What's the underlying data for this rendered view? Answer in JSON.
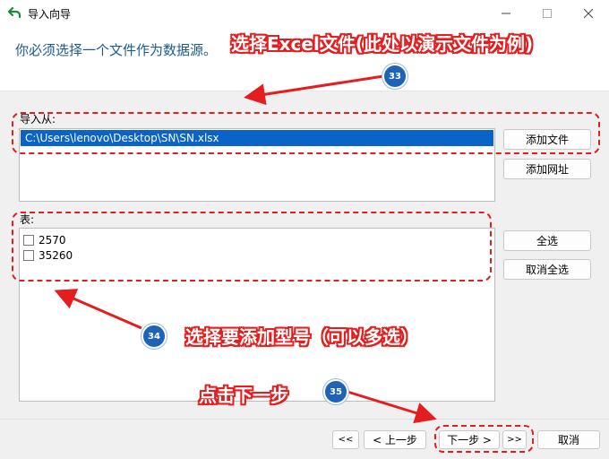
{
  "window": {
    "title": "导入向导",
    "minimize_icon": "minimize-icon",
    "maximize_icon": "maximize-icon",
    "close_icon": "close-icon"
  },
  "instruction": "你必须选择一个文件作为数据源。",
  "import_from": {
    "label": "导入从:",
    "files": [
      "C:\\Users\\lenovo\\Desktop\\SN\\SN.xlsx"
    ],
    "add_file_button": "添加文件",
    "add_url_button": "添加网址"
  },
  "tables": {
    "label": "表:",
    "items": [
      {
        "name": "2570",
        "checked": false
      },
      {
        "name": "35260",
        "checked": false
      }
    ],
    "select_all_button": "全选",
    "deselect_all_button": "取消全选"
  },
  "nav": {
    "first_button": "<<",
    "prev_button": "< 上一步",
    "next_button": "下一步 >",
    "last_button": ">>",
    "cancel_button": "取消"
  },
  "annotations": {
    "step33_text": "选择Excel文件(此处以演示文件为例)",
    "step33_badge": "33",
    "step34_text": "选择要添加型号（可以多选）",
    "step34_badge": "34",
    "step35_text": "点击下一步",
    "step35_badge": "35"
  },
  "colors": {
    "annotation_red": "#e41e1e",
    "badge_blue": "#1f63b8",
    "selection_blue": "#0a63c9",
    "instruction_blue": "#1c5a8e"
  }
}
